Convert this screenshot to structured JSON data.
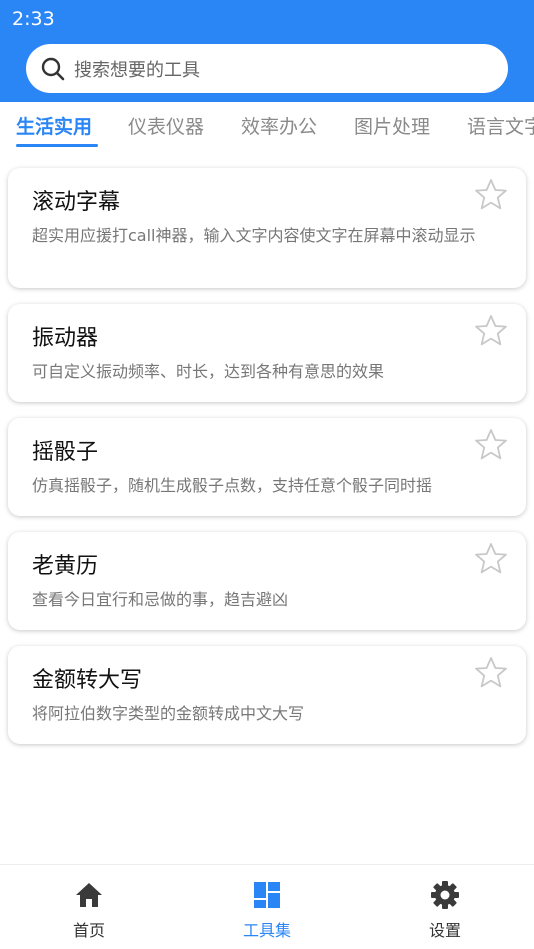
{
  "status_bar": {
    "time": "2:33"
  },
  "search": {
    "placeholder": "搜索想要的工具"
  },
  "tabs": [
    {
      "label": "生活实用",
      "active": true
    },
    {
      "label": "仪表仪器",
      "active": false
    },
    {
      "label": "效率办公",
      "active": false
    },
    {
      "label": "图片处理",
      "active": false
    },
    {
      "label": "语言文字",
      "active": false
    }
  ],
  "tools": [
    {
      "title": "滚动字幕",
      "description": "超实用应援打call神器，输入文字内容使文字在屏幕中滚动显示",
      "starred": false
    },
    {
      "title": "振动器",
      "description": "可自定义振动频率、时长，达到各种有意思的效果",
      "starred": false
    },
    {
      "title": "摇骰子",
      "description": "仿真摇骰子，随机生成骰子点数，支持任意个骰子同时摇",
      "starred": false
    },
    {
      "title": "老黄历",
      "description": "查看今日宜行和忌做的事，趋吉避凶",
      "starred": false
    },
    {
      "title": "金额转大写",
      "description": "将阿拉伯数字类型的金额转成中文大写",
      "starred": false
    }
  ],
  "bottom_nav": [
    {
      "label": "首页",
      "icon": "home-icon",
      "active": false
    },
    {
      "label": "工具集",
      "icon": "grid-icon",
      "active": true
    },
    {
      "label": "设置",
      "icon": "gear-icon",
      "active": false
    }
  ],
  "colors": {
    "accent": "#2b86f5",
    "inactive_tab": "#8a8a8a",
    "description": "#777777",
    "star_outline": "#c8c8c8"
  }
}
